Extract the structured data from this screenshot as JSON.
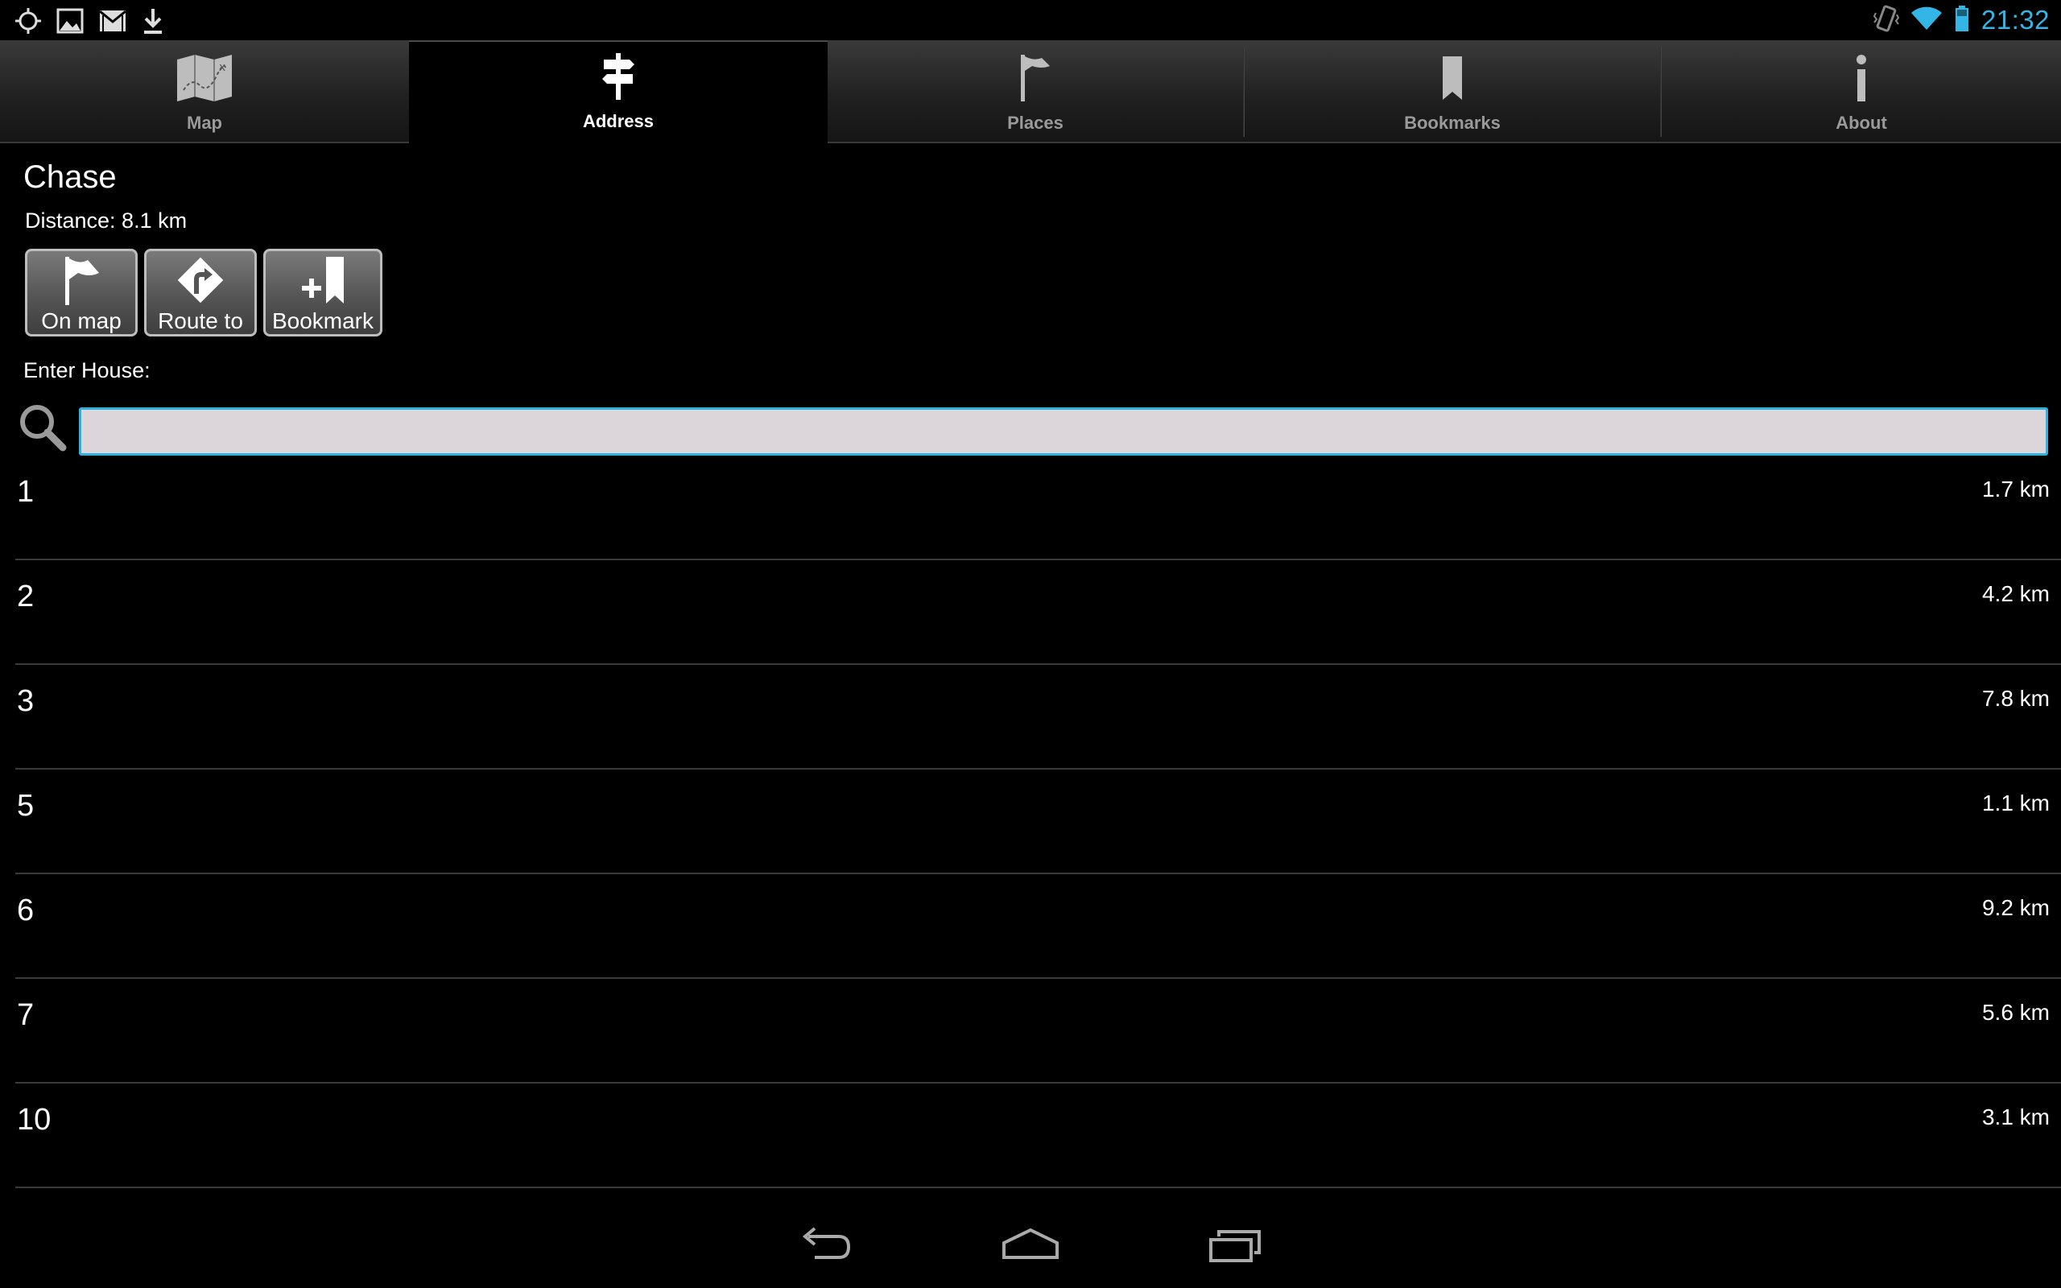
{
  "status_bar": {
    "time": "21:32",
    "left_icons": [
      "gps-icon",
      "gallery-icon",
      "gmail-icon",
      "download-icon"
    ],
    "right_icons": [
      "vibrate-icon",
      "wifi-icon",
      "battery-icon"
    ],
    "accent_color": "#33b5e5"
  },
  "tabs": [
    {
      "label": "Map",
      "icon": "map-icon",
      "active": false
    },
    {
      "label": "Address",
      "icon": "signpost-icon",
      "active": true
    },
    {
      "label": "Places",
      "icon": "flag-icon",
      "active": false
    },
    {
      "label": "Bookmarks",
      "icon": "bookmark-icon",
      "active": false
    },
    {
      "label": "About",
      "icon": "info-icon",
      "active": false
    }
  ],
  "header": {
    "street": "Chase",
    "distance": "Distance: 8.1 km"
  },
  "actions": {
    "on_map": "On map",
    "route_to": "Route to",
    "bookmark": "Bookmark"
  },
  "search": {
    "label": "Enter House:",
    "value": "",
    "placeholder": "",
    "focus_color": "#2fb0dd"
  },
  "houses": [
    {
      "number": "1",
      "distance": "1.7 km"
    },
    {
      "number": "2",
      "distance": "4.2 km"
    },
    {
      "number": "3",
      "distance": "7.8 km"
    },
    {
      "number": "5",
      "distance": "1.1 km"
    },
    {
      "number": "6",
      "distance": "9.2 km"
    },
    {
      "number": "7",
      "distance": "5.6 km"
    },
    {
      "number": "10",
      "distance": "3.1 km"
    }
  ],
  "nav_bar": {
    "icons": [
      "back-icon",
      "home-icon",
      "recent-apps-icon"
    ]
  }
}
